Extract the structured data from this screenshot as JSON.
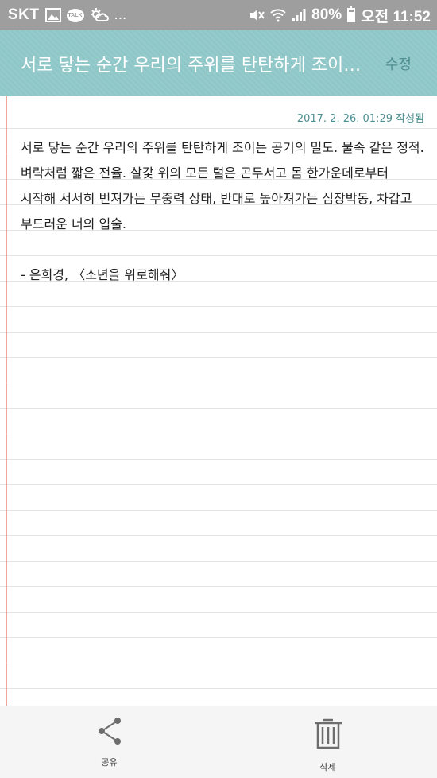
{
  "status_bar": {
    "carrier": "SKT",
    "icons": [
      "image-icon",
      "talk-icon",
      "weather-icon"
    ],
    "talk_label": "TALK",
    "more": "...",
    "right_icons": [
      "mute-icon",
      "wifi-icon",
      "signal-icon"
    ],
    "battery_percent": "80%",
    "battery_level": 0.8,
    "time": "오전 11:52"
  },
  "header": {
    "title": "서로 닿는 순간 우리의 주위를 탄탄하게 조이는 공기의 밀도. 물속 같은 정적.",
    "edit_label": "수정"
  },
  "note": {
    "date": "2017. 2. 26. 01:29 작성됨",
    "lines": [
      "서로 닿는 순간 우리의 주위를 탄탄하게 조이는 공기의 밀도. 물속 같은 정적.",
      "벼락처럼 짧은 전율. 살갗 위의 모든 털은 곤두서고 몸 한가운데로부터",
      "시작해 서서히 번져가는 무중력 상태, 반대로 높아져가는 심장박동, 차갑고",
      "부드러운 너의 입술.",
      "",
      "- 은희경, 〈소년을 위로해줘〉"
    ]
  },
  "bottom_bar": {
    "share_label": "공유",
    "delete_label": "삭제"
  },
  "colors": {
    "header": "#8fc7c8",
    "accent": "#4f8f92",
    "margin_line": "#f0a59a",
    "status_bar": "#9e9e9e"
  }
}
